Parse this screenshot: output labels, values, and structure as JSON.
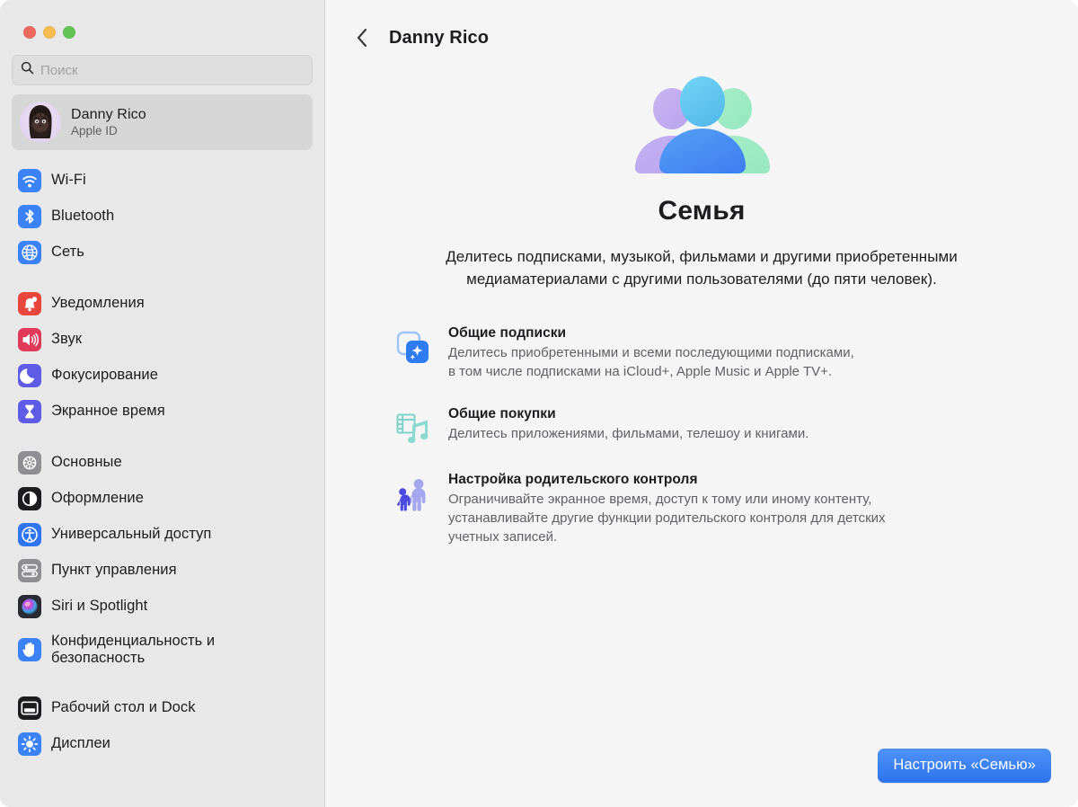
{
  "window": {
    "traffic_lights": [
      {
        "name": "close",
        "color": "#ee6a5f"
      },
      {
        "name": "minimize",
        "color": "#f5bd4f"
      },
      {
        "name": "maximize",
        "color": "#61c454"
      }
    ]
  },
  "sidebar": {
    "search": {
      "placeholder": "Поиск",
      "value": "",
      "icon": "search-icon"
    },
    "account": {
      "name": "Danny Rico",
      "subtitle": "Apple ID",
      "avatar_icon": "memoji-avatar",
      "selected": true
    },
    "groups": [
      {
        "items": [
          {
            "label": "Wi-Fi",
            "icon": "wifi-icon",
            "color": "#3b82f6"
          },
          {
            "label": "Bluetooth",
            "icon": "bluetooth-icon",
            "color": "#3b82f6"
          },
          {
            "label": "Сеть",
            "icon": "network-globe-icon",
            "color": "#3b82f6"
          }
        ]
      },
      {
        "items": [
          {
            "label": "Уведомления",
            "icon": "notifications-bell-icon",
            "color": "#e8463c"
          },
          {
            "label": "Звук",
            "icon": "sound-speaker-icon",
            "color": "#e0395a"
          },
          {
            "label": "Фокусирование",
            "icon": "focus-moon-icon",
            "color": "#5e5ce6"
          },
          {
            "label": "Экранное время",
            "icon": "screen-time-hourglass-icon",
            "color": "#5e5ce6"
          }
        ]
      },
      {
        "items": [
          {
            "label": "Основные",
            "icon": "general-gear-icon",
            "color": "#8e8e93"
          },
          {
            "label": "Оформление",
            "icon": "appearance-contrast-icon",
            "color": "#1c1c1e"
          },
          {
            "label": "Универсальный доступ",
            "icon": "accessibility-icon",
            "color": "#2f74f0"
          },
          {
            "label": "Пункт управления",
            "icon": "control-center-icon",
            "color": "#8e8e93"
          },
          {
            "label": "Siri и Spotlight",
            "icon": "siri-icon",
            "color": "#2b2b33"
          },
          {
            "label": "Конфиденциальность и\nбезопасность",
            "icon": "privacy-hand-icon",
            "color": "#3b82f6",
            "two_line": true
          }
        ]
      },
      {
        "items": [
          {
            "label": "Рабочий стол и Dock",
            "icon": "desktop-dock-icon",
            "color": "#1c1c1e"
          },
          {
            "label": "Дисплеи",
            "icon": "displays-brightness-icon",
            "color": "#3b82f6"
          }
        ]
      }
    ]
  },
  "content": {
    "back_label": "back-chevron",
    "title": "Danny Rico",
    "hero": {
      "icon": "family-group-icon",
      "heading": "Семья",
      "description": "Делитесь подписками, музыкой, фильмами и другими приобретенными медиаматериалами с другими пользователями (до пяти человек)."
    },
    "features": [
      {
        "icon": "shared-subscriptions-icon",
        "title": "Общие подписки",
        "description": "Делитесь приобретенными и всеми последующими подписками,\nв том числе подписками на iCloud+, Apple Music и Apple TV+."
      },
      {
        "icon": "shared-purchases-icon",
        "title": "Общие покупки",
        "description": "Делитесь приложениями, фильмами, телешоу и книгами."
      },
      {
        "icon": "parental-controls-icon",
        "title": "Настройка родительского контроля",
        "description": "Ограничивайте экранное время, доступ к тому или иному контенту,\nустанавливайте другие функции родительского контроля для детских\nучетных записей."
      }
    ],
    "primary_button": {
      "label": "Настроить «Семью»",
      "color": "#2d73ef"
    }
  }
}
